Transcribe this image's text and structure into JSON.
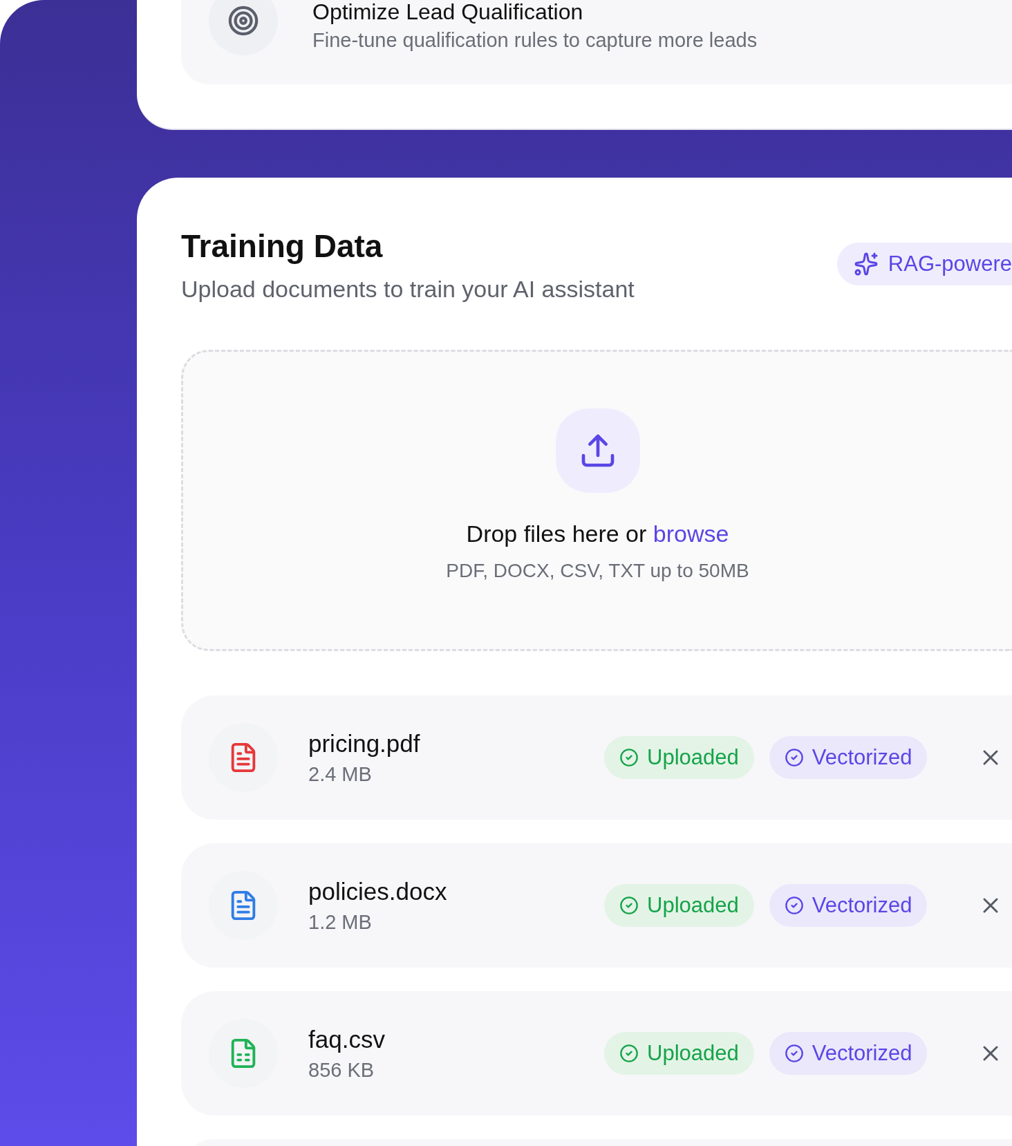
{
  "goal": {
    "title": "Optimize Lead Qualification",
    "description": "Fine-tune qualification rules to capture more leads"
  },
  "training": {
    "title": "Training Data",
    "subtitle": "Upload documents to train your AI assistant",
    "badge": "RAG-powere",
    "dropzone": {
      "prompt": "Drop files here or",
      "link": "browse",
      "hint": "PDF, DOCX, CSV, TXT up to 50MB"
    },
    "files": [
      {
        "kind": "pdf",
        "name": "pricing.pdf",
        "size": "2.4 MB",
        "statuses": [
          {
            "kind": "uploaded",
            "label": "Uploaded"
          },
          {
            "kind": "vectorized",
            "label": "Vectorized"
          }
        ]
      },
      {
        "kind": "doc",
        "name": "policies.docx",
        "size": "1.2 MB",
        "statuses": [
          {
            "kind": "uploaded",
            "label": "Uploaded"
          },
          {
            "kind": "vectorized",
            "label": "Vectorized"
          }
        ]
      },
      {
        "kind": "sheet",
        "name": "faq.csv",
        "size": "856 KB",
        "statuses": [
          {
            "kind": "uploaded",
            "label": "Uploaded"
          },
          {
            "kind": "vectorized",
            "label": "Vectorized"
          }
        ]
      }
    ]
  }
}
